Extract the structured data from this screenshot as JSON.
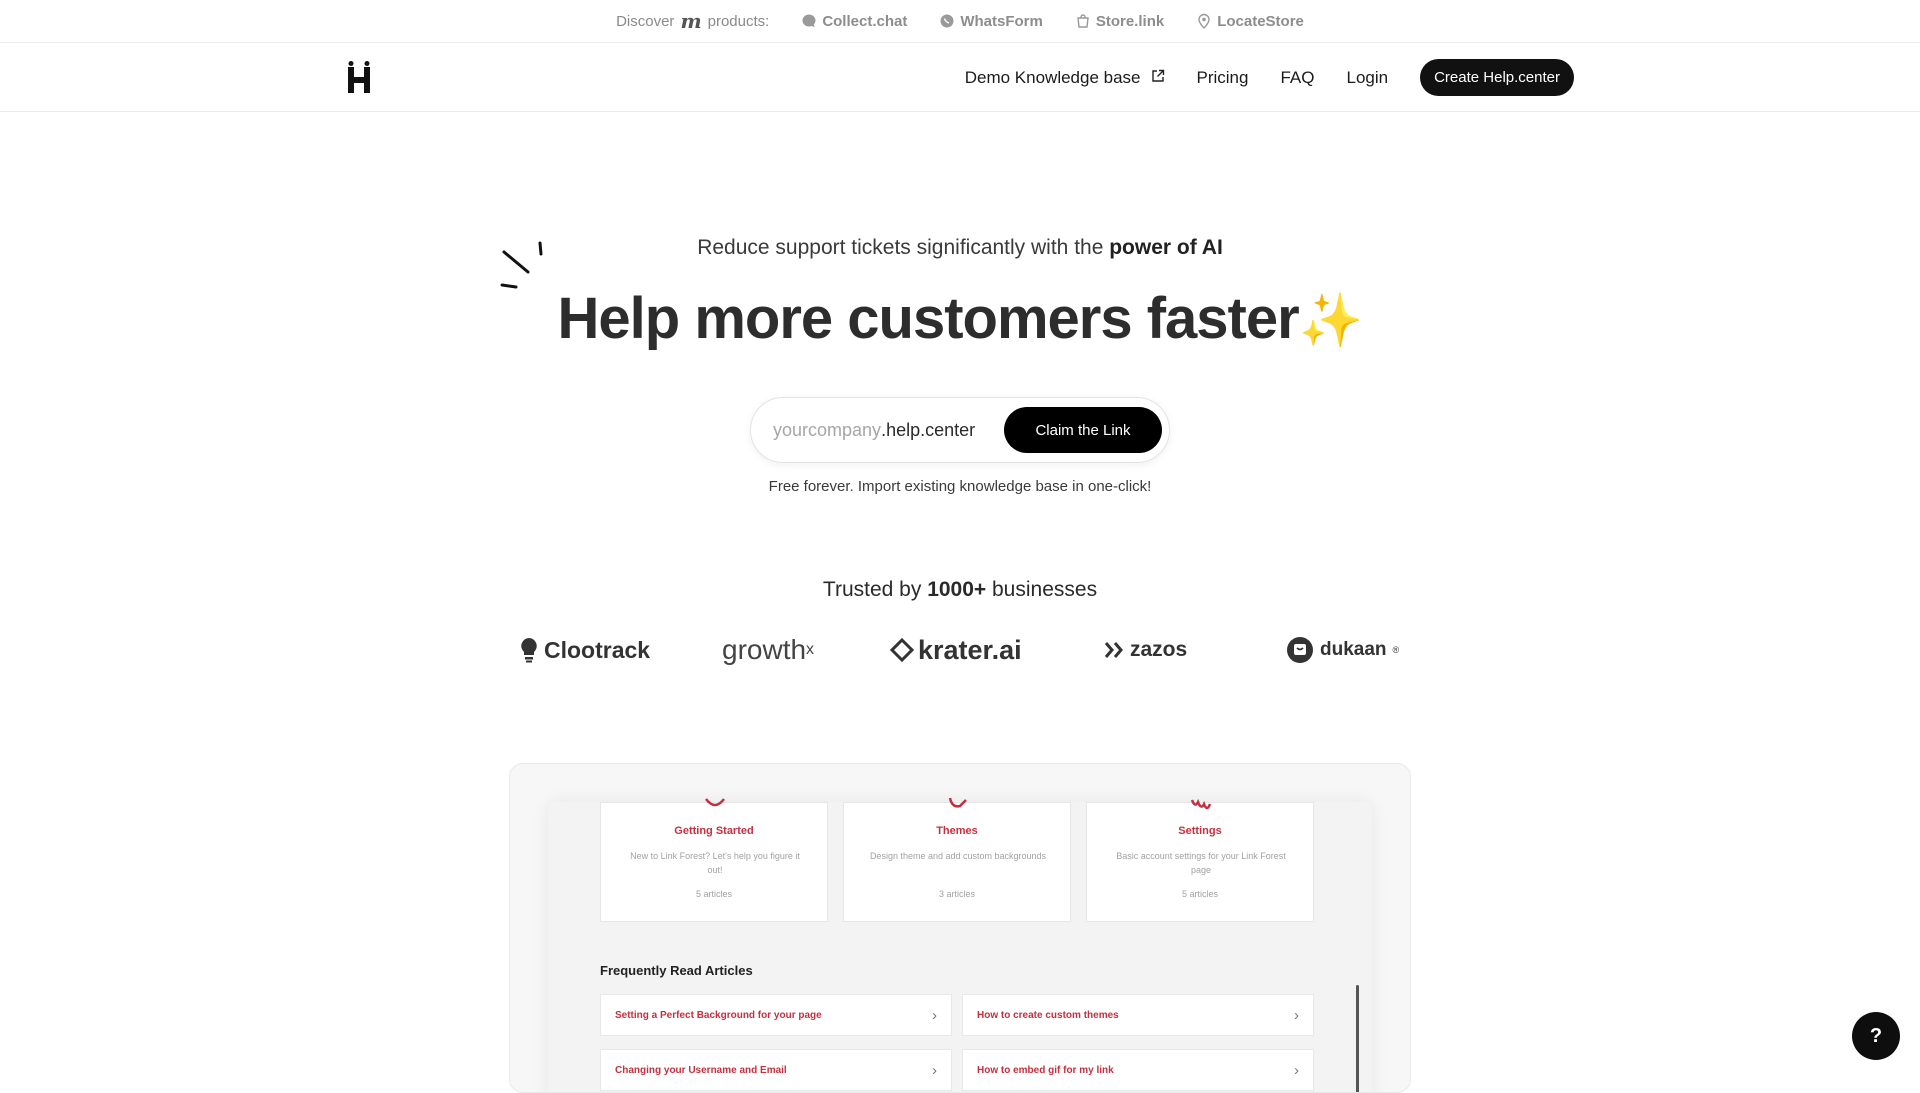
{
  "topbar": {
    "discover_label": "Discover",
    "brand_letter": "m",
    "products_label": "products:",
    "products": [
      {
        "label": "Collect.chat",
        "icon": "chat-bubble-icon"
      },
      {
        "label": "WhatsForm",
        "icon": "whatsapp-icon"
      },
      {
        "label": "Store.link",
        "icon": "shopping-bag-icon"
      },
      {
        "label": "LocateStore",
        "icon": "map-pin-icon"
      }
    ]
  },
  "nav": {
    "logo_icon": "helpcenter-logo-icon",
    "demo_label": "Demo Knowledge base",
    "pricing_label": "Pricing",
    "faq_label": "FAQ",
    "login_label": "Login",
    "cta_label": "Create Help.center"
  },
  "hero": {
    "tagline_prefix": "Reduce support tickets significantly with the ",
    "tagline_bold": "power of AI",
    "headline": "Help more customers faster",
    "headline_emoji": "✨",
    "input_placeholder": "yourcompany",
    "input_suffix": ".help.center",
    "claim_button": "Claim the Link",
    "free_note": "Free forever. Import existing knowledge base in one-click!"
  },
  "trusted": {
    "prefix": "Trusted by ",
    "bold": "1000+",
    "suffix": " businesses"
  },
  "logos": {
    "clootrack": "Clootrack",
    "growthx": "growth",
    "growthx_sup": "x",
    "krater": "krater.ai",
    "zazos": "zazos",
    "dukaan": "dukaan",
    "dukaan_reg": "®"
  },
  "preview": {
    "cards": [
      {
        "title": "Getting Started",
        "desc": "New to Link Forest? Let's help you figure it out!",
        "count": "5 articles"
      },
      {
        "title": "Themes",
        "desc": "Design theme and add custom backgrounds",
        "count": "3 articles"
      },
      {
        "title": "Settings",
        "desc": "Basic account settings for your Link Forest page",
        "count": "5 articles"
      }
    ],
    "freq_title": "Frequently Read Articles",
    "articles": [
      "Setting a Perfect Background for your page",
      "How to create custom themes",
      "Changing your Username and Email",
      "How to embed gif for my link"
    ]
  },
  "help_button": "?",
  "colors": {
    "accent_red": "#c4303f",
    "cta_black": "#111111",
    "sparkle_yellow": "#f3c433"
  }
}
